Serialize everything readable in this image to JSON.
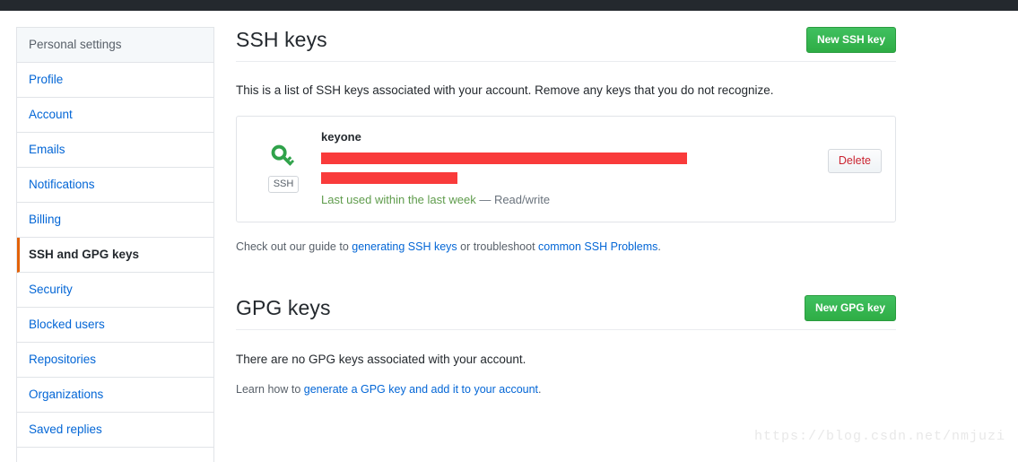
{
  "topbar": {
    "present": true,
    "color": "#24292e"
  },
  "sidebar": {
    "header": "Personal settings",
    "items": [
      {
        "label": "Profile",
        "active": false
      },
      {
        "label": "Account",
        "active": false
      },
      {
        "label": "Emails",
        "active": false
      },
      {
        "label": "Notifications",
        "active": false
      },
      {
        "label": "Billing",
        "active": false
      },
      {
        "label": "SSH and GPG keys",
        "active": true
      },
      {
        "label": "Security",
        "active": false
      },
      {
        "label": "Blocked users",
        "active": false
      },
      {
        "label": "Repositories",
        "active": false
      },
      {
        "label": "Organizations",
        "active": false
      },
      {
        "label": "Saved replies",
        "active": false
      }
    ],
    "active_accent": "#e36209"
  },
  "ssh_section": {
    "title": "SSH keys",
    "new_button": "New SSH key",
    "lead": "This is a list of SSH keys associated with your account. Remove any keys that you do not recognize.",
    "key": {
      "icon": "key-icon",
      "badge": "SSH",
      "title": "keyone",
      "fingerprint_redacted": true,
      "added_redacted": true,
      "last_used": "Last used within the last week",
      "permission": " — Read/write",
      "delete_button": "Delete"
    },
    "guide": {
      "prefix": "Check out our guide to ",
      "link1": "generating SSH keys",
      "middle": " or troubleshoot ",
      "link2": "common SSH Problems",
      "suffix": "."
    }
  },
  "gpg_section": {
    "title": "GPG keys",
    "new_button": "New GPG key",
    "empty_message": "There are no GPG keys associated with your account.",
    "learn": {
      "prefix": "Learn how to ",
      "link": "generate a GPG key and add it to your account",
      "suffix": "."
    }
  },
  "watermark": "https://blog.csdn.net/nmjuzi",
  "colors": {
    "green_button": "#35b94b",
    "link": "#0366d6",
    "redaction": "#f93b3b",
    "delete_text": "#cb2431",
    "last_used_green": "#5f9c4c",
    "border": "#e1e4e8"
  }
}
